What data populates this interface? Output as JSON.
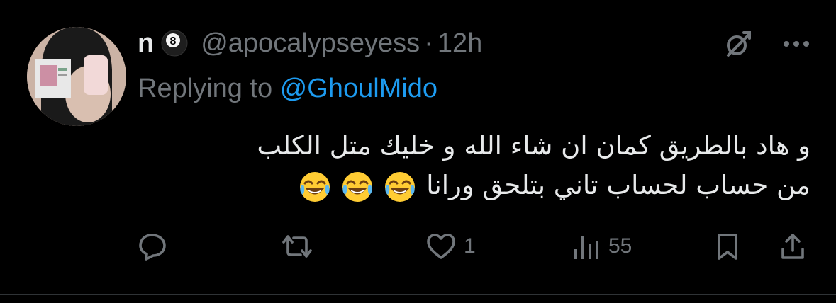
{
  "tweet": {
    "display_name": "n",
    "name_emoji": "pool-8-ball-emoji",
    "handle": "@apocalypseyess",
    "separator": "·",
    "time": "12h",
    "replying_prefix": "Replying to ",
    "replying_to": "@GhoulMido",
    "text_line_1": "و هاد بالطريق كمان ان شاء الله و خليك متل الكلب",
    "text_line_2": "من حساب لحساب تاني بتلحق ورانا",
    "text_emojis": [
      "face-with-tears-of-joy",
      "face-with-tears-of-joy",
      "face-with-tears-of-joy"
    ]
  },
  "actions": {
    "reply_count": "",
    "retweet_count": "",
    "like_count": "1",
    "views_count": "55"
  },
  "icons": {
    "grok": "grok-icon",
    "more": "more-icon",
    "reply": "reply-icon",
    "retweet": "retweet-icon",
    "like": "heart-icon",
    "views": "views-icon",
    "bookmark": "bookmark-icon",
    "share": "share-icon"
  },
  "colors": {
    "background": "#000000",
    "text": "#e7e9ea",
    "muted": "#71767b",
    "link": "#1d9bf0",
    "divider": "#2f3336"
  }
}
